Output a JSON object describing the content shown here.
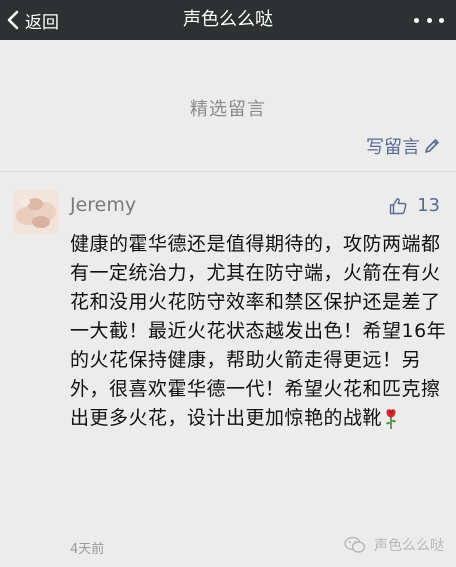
{
  "navbar": {
    "back_label": "返回",
    "title": "声色么么哒"
  },
  "section": {
    "title": "精选留言",
    "write_label": "写留言"
  },
  "comment": {
    "author": "Jeremy",
    "like_count": "13",
    "text": "健康的霍华德还是值得期待的，攻防两端都有一定统治力，尤其在防守端，火箭在有火花和没用火花防守效率和禁区保护还是差了一大截！最近火花状态越发出色！希望16年的火花保持健康，帮助火箭走得更远！另外，很喜欢霍华德一代！希望火花和匹克擦出更多火花，设计出更加惊艳的战靴",
    "time": "4天前"
  },
  "watermark": {
    "label": "声色么么哒"
  },
  "colors": {
    "navbar_bg": "#2e3132",
    "page_bg": "#ececec",
    "link": "#576b95"
  }
}
